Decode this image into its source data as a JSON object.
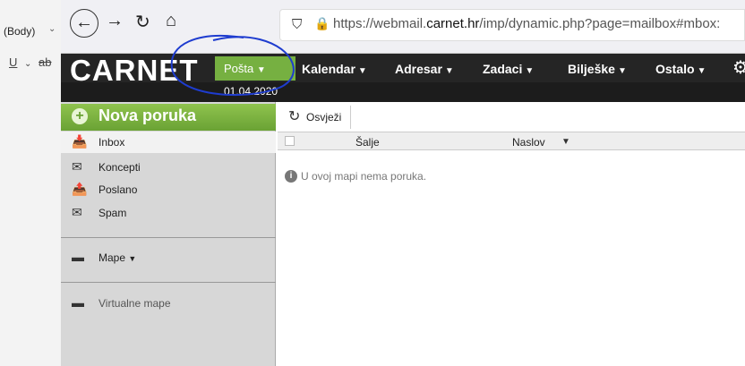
{
  "word": {
    "style_label": "(Body)",
    "underline": "U",
    "strike": "ab"
  },
  "browser": {
    "url_prefix": "https://webmail.",
    "url_domain": "carnet.hr",
    "url_rest": "/imp/dynamic.php?page=mailbox#mbox:"
  },
  "app": {
    "logo": "CARNET",
    "menu": [
      {
        "label": "Pošta"
      },
      {
        "label": "Kalendar"
      },
      {
        "label": "Adresar"
      },
      {
        "label": "Zadaci"
      },
      {
        "label": "Bilješke"
      },
      {
        "label": "Ostalo"
      }
    ],
    "date": "01.04.2020"
  },
  "sidebar": {
    "new_message": "Nova poruka",
    "folders": [
      {
        "label": "Inbox",
        "icon": "inbox-icon"
      },
      {
        "label": "Koncepti",
        "icon": "drafts-icon"
      },
      {
        "label": "Poslano",
        "icon": "sent-icon"
      },
      {
        "label": "Spam",
        "icon": "spam-icon"
      }
    ],
    "mape": "Mape",
    "virtual": "Virtualne mape"
  },
  "main": {
    "refresh": "Osvježi",
    "col_from": "Šalje",
    "col_subject": "Naslov",
    "empty": "U ovoj mapi nema poruka."
  },
  "colors": {
    "accent": "#76b041",
    "header": "#252525",
    "sidebar": "#d7d7d7"
  }
}
